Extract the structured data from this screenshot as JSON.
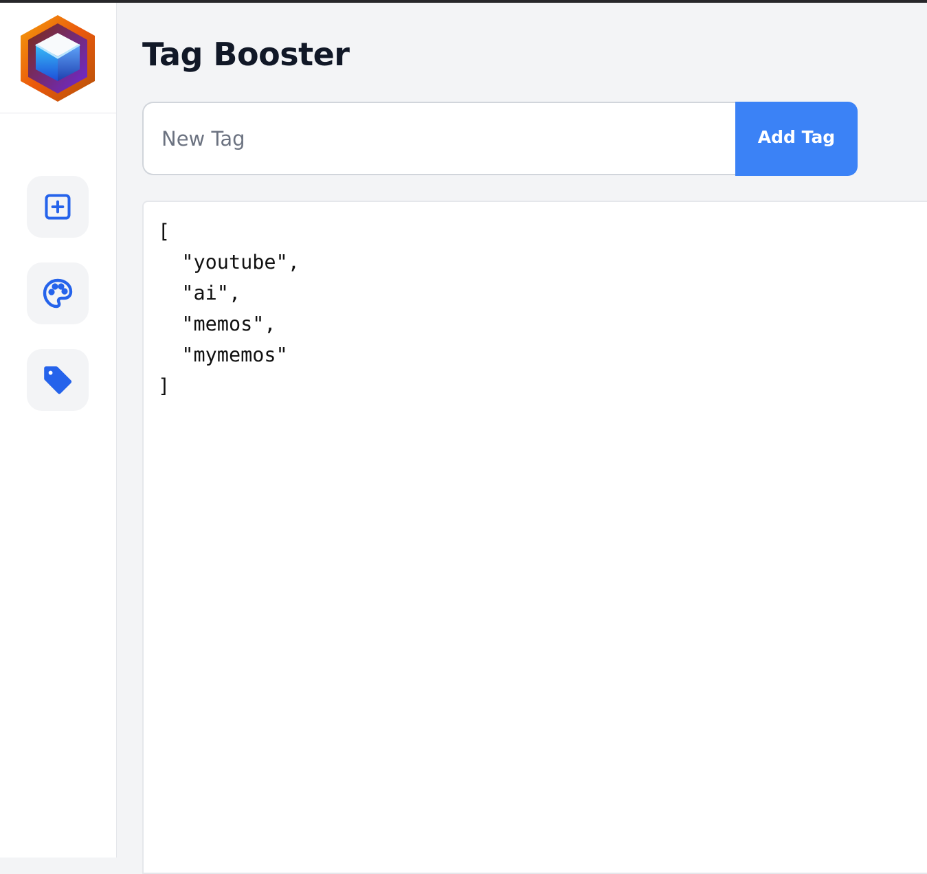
{
  "app": {
    "title": "Tag Booster"
  },
  "sidebar": {
    "logo_icon": "cube-hexagon-logo-icon",
    "items": [
      {
        "name": "add-memo",
        "icon": "plus-square-icon"
      },
      {
        "name": "theme",
        "icon": "palette-icon"
      },
      {
        "name": "tags",
        "icon": "tag-icon"
      }
    ]
  },
  "form": {
    "input_placeholder": "New Tag",
    "input_value": "",
    "add_label": "Add Tag"
  },
  "tags_json": "[\n  \"youtube\",\n  \"ai\",\n  \"memos\",\n  \"mymemos\"\n]",
  "tags": [
    "youtube",
    "ai",
    "memos",
    "mymemos"
  ],
  "colors": {
    "accent": "#3b82f6",
    "icon": "#2563eb",
    "background": "#f3f4f6",
    "title": "#111827"
  }
}
